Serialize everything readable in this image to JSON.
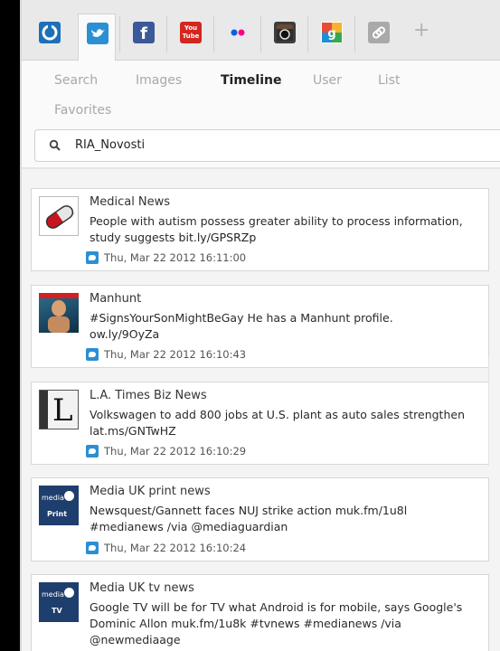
{
  "services": [
    {
      "name": "simplenote",
      "label": "S",
      "bg": "#1e6fb8"
    },
    {
      "name": "twitter",
      "label": "t",
      "bg": "#2b8fd3"
    },
    {
      "name": "facebook",
      "label": "f",
      "bg": "#3b5998"
    },
    {
      "name": "youtube",
      "label": "You\nTube",
      "bg": "#d3261f"
    },
    {
      "name": "flickr",
      "label": "••",
      "bg": "#e8e8ee"
    },
    {
      "name": "instagram",
      "label": "◙",
      "bg": "#3d3d3d"
    },
    {
      "name": "google",
      "label": "g",
      "bg": "#f3b431"
    },
    {
      "name": "link",
      "label": "∞",
      "bg": "#a9a9a9"
    }
  ],
  "add_label": "+",
  "tabs": {
    "search": "Search",
    "images": "Images",
    "timeline": "Timeline",
    "user": "User",
    "list": "List",
    "favorites": "Favorites"
  },
  "search": {
    "value": "RIA_Novosti"
  },
  "tweets": [
    {
      "author": "Medical News",
      "text": "People with autism possess greater ability to process information, study suggests",
      "link": "bit.ly/GPSRZp",
      "time": "Thu, Mar 22 2012 16:11:00"
    },
    {
      "author": "Manhunt",
      "text": "#SignsYourSonMightBeGay He has a Manhunt profile.",
      "link": "ow.ly/9OyZa",
      "time": "Thu, Mar 22 2012 16:10:43"
    },
    {
      "author": "L.A. Times Biz News",
      "text": "Volkswagen to add 800 jobs at U.S. plant as auto sales strengthen",
      "link": "lat.ms/GNTwHZ",
      "time": "Thu, Mar 22 2012 16:10:29"
    },
    {
      "author": "Media UK print news",
      "text": "Newsquest/Gannett faces NUJ strike action",
      "link": "muk.fm/1u8l",
      "extra": "#medianews /via @mediaguardian",
      "time": "Thu, Mar 22 2012 16:10:24"
    },
    {
      "author": "Media UK tv news",
      "text": "Google TV will be for TV what Android is for mobile, says Google's Dominic Allon",
      "link": "muk.fm/1u8k",
      "extra": "#tvnews #medianews /via @newmediaage"
    }
  ],
  "avatar_labels": {
    "latimes": "L",
    "media_print": "Print",
    "media_tv": "TV",
    "media_brand": "media"
  }
}
